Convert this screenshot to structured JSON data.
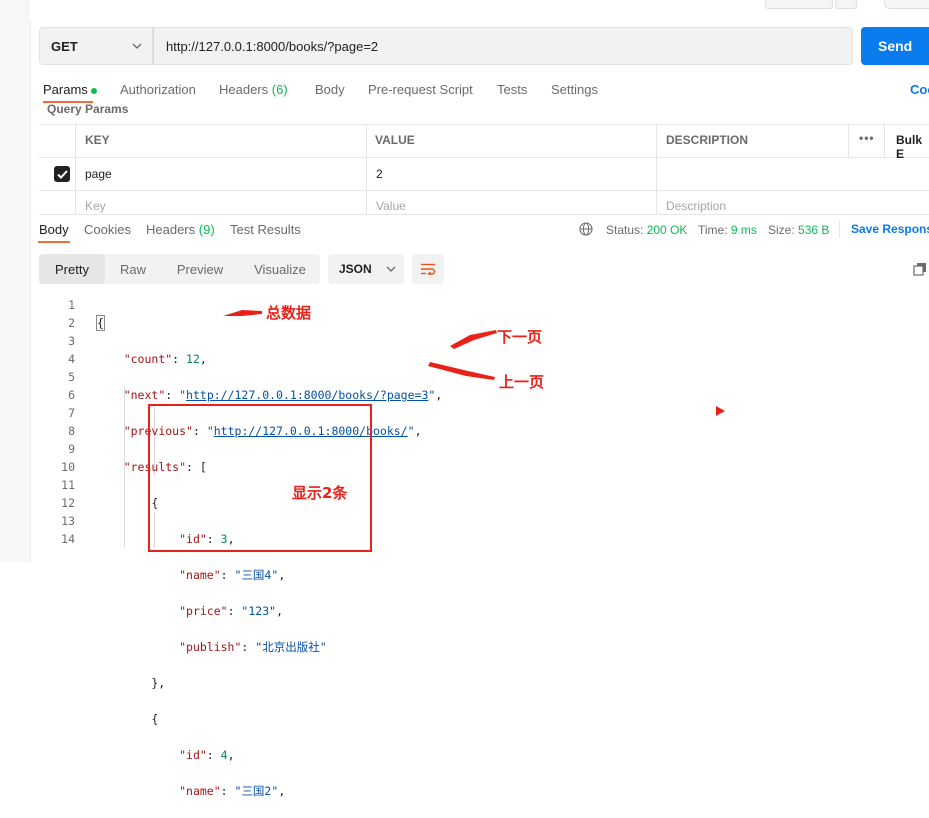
{
  "request": {
    "method": "GET",
    "url": "http://127.0.0.1:8000/books/?page=2",
    "send_label": "Send"
  },
  "request_tabs": {
    "params": "Params",
    "authorization": "Authorization",
    "headers": "Headers",
    "headers_count": "(6)",
    "body": "Body",
    "prerequest": "Pre-request Script",
    "tests": "Tests",
    "settings": "Settings",
    "cookies_cut": "Coo"
  },
  "query_params": {
    "title": "Query Params",
    "columns": {
      "key": "KEY",
      "value": "VALUE",
      "description": "DESCRIPTION",
      "bulk_edit": "Bulk E"
    },
    "rows": [
      {
        "key": "page",
        "value": "2"
      }
    ],
    "placeholders": {
      "key": "Key",
      "value": "Value",
      "description": "Description"
    }
  },
  "response_tabs": {
    "body": "Body",
    "cookies": "Cookies",
    "headers": "Headers",
    "headers_count": "(9)",
    "test_results": "Test Results"
  },
  "response_status": {
    "status_label": "Status:",
    "status_value": "200 OK",
    "time_label": "Time:",
    "time_value": "9 ms",
    "size_label": "Size:",
    "size_value": "536 B",
    "save_response": "Save Respons"
  },
  "view_modes": {
    "pretty": "Pretty",
    "raw": "Raw",
    "preview": "Preview",
    "visualize": "Visualize",
    "format": "JSON"
  },
  "code": {
    "line_numbers": [
      "1",
      "2",
      "3",
      "4",
      "5",
      "6",
      "7",
      "8",
      "9",
      "10",
      "11",
      "12",
      "13",
      "14"
    ],
    "count": "12",
    "next": "http://127.0.0.1:8000/books/?page=3",
    "previous": "http://127.0.0.1:8000/books/",
    "item1": {
      "id": "3",
      "name": "三国4",
      "price": "123",
      "publish": "北京出版社"
    },
    "item2": {
      "id": "4",
      "name": "三国2"
    }
  },
  "annotations": {
    "total": "总数据",
    "next_page": "下一页",
    "prev_page": "上一页",
    "shows_two": "显示2条"
  },
  "colors": {
    "accent": "#097bed",
    "tab_underline": "#f26b3a",
    "success": "#0cbb52",
    "annotation_red": "#e8221b"
  }
}
